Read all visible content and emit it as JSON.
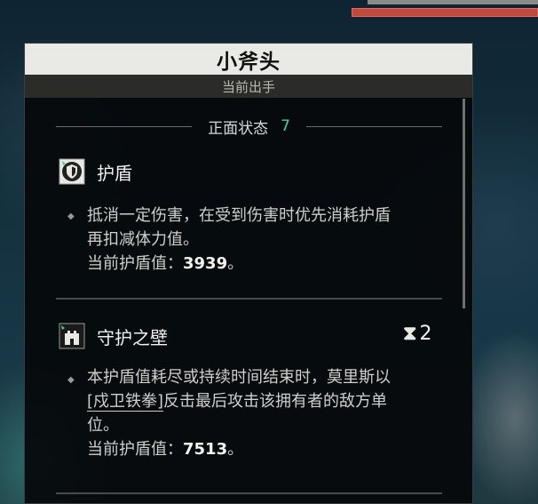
{
  "hud": {
    "bar_colors": {
      "top": "#8a8a8a",
      "health": "#c0483c"
    }
  },
  "tooltip": {
    "title": "小斧头",
    "subtitle": "当前出手",
    "section": {
      "label": "正面状态",
      "count": "7",
      "count_color": "#3fd2a0"
    },
    "entries": [
      {
        "icon": "shield-icon",
        "name": "护盾",
        "desc_line1": "抵消一定伤害，在受到伤害时优先消耗护盾",
        "desc_line2": "再扣减体力值。",
        "value_prefix": "当前护盾值：",
        "value": "3939",
        "value_suffix": "。"
      },
      {
        "icon": "fortress-wall-icon",
        "name": "守护之壁",
        "stack_symbol": "⧗",
        "stack_count": "2",
        "desc_line1": "本护盾值耗尽或持续时间结束时，莫里斯以",
        "desc_tag": "[戍卫铁拳]",
        "desc_line2_rest": "反击最后攻击该拥有者的敌方单",
        "desc_line3": "位。",
        "value_prefix": "当前护盾值：",
        "value": "7513",
        "value_suffix": "。"
      }
    ]
  }
}
